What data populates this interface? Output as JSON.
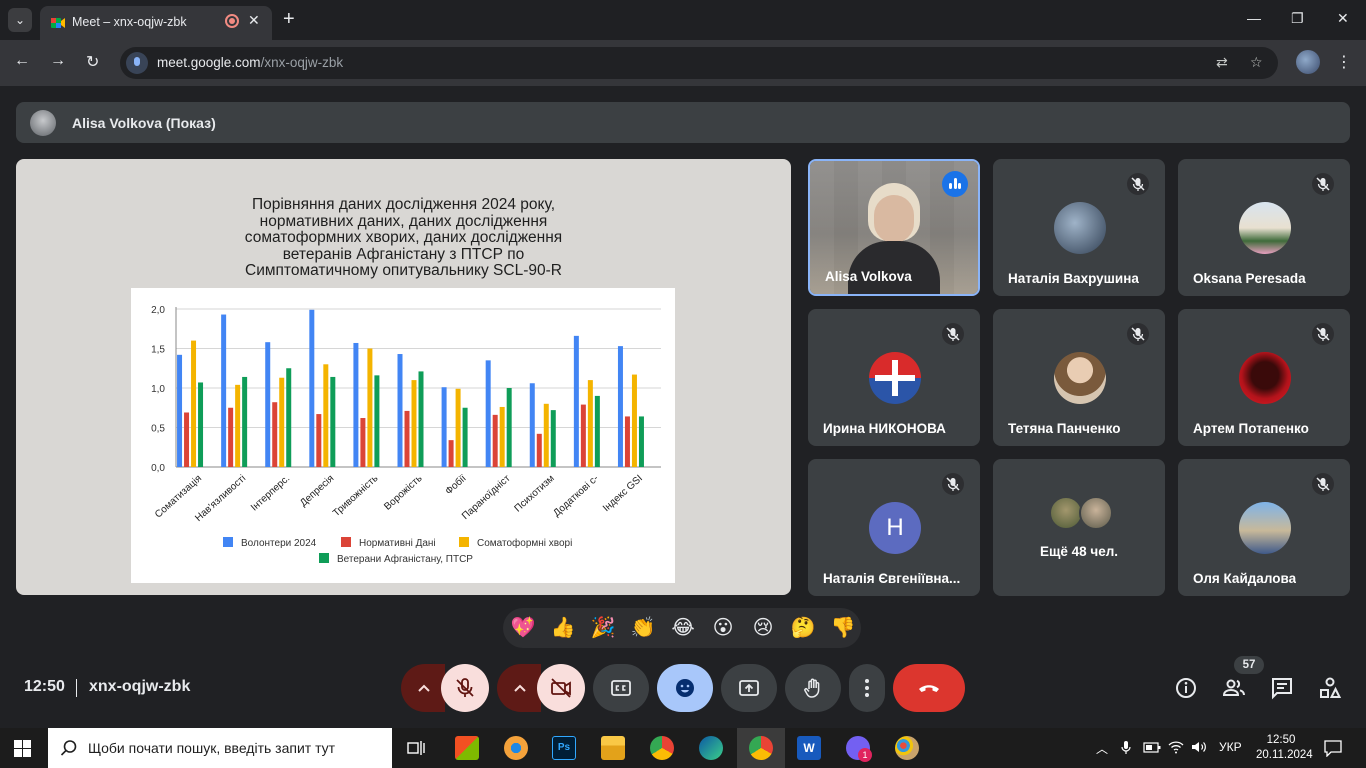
{
  "browser": {
    "tab_title": "Meet – xnx-oqjw-zbk",
    "url_host": "meet.google.com",
    "url_path": "/xnx-oqjw-zbk"
  },
  "presenter": {
    "label": "Alisa Volkova (Показ)"
  },
  "slide": {
    "title": "Порівняння даних дослідження 2024 року,\nнормативних даних, даних дослідження\nсоматоформних хворих, даних дослідження\nветеранів Афганістану з ПТСР по\nСимптоматичному опитувальнику SCL-90-R"
  },
  "chart_data": {
    "type": "bar",
    "categories": [
      "Соматизація",
      "Нав'язливості",
      "Інтерперс.",
      "Депресія",
      "Тривожність",
      "Ворожість",
      "Фобії",
      "Параноїдніст",
      "Психотизм",
      "Додаткові с-",
      "Індекс GSI"
    ],
    "series": [
      {
        "name": "Волонтери 2024",
        "color": "#4285f4",
        "values": [
          1.42,
          1.93,
          1.58,
          1.99,
          1.57,
          1.43,
          1.01,
          1.35,
          1.06,
          1.66,
          1.53
        ]
      },
      {
        "name": "Нормативні Дані",
        "color": "#db4437",
        "values": [
          0.69,
          0.75,
          0.82,
          0.67,
          0.62,
          0.71,
          0.34,
          0.66,
          0.42,
          0.79,
          0.64
        ]
      },
      {
        "name": "Соматоформні хворі",
        "color": "#f4b400",
        "values": [
          1.6,
          1.04,
          1.13,
          1.3,
          1.5,
          1.1,
          0.99,
          0.76,
          0.8,
          1.1,
          1.17
        ]
      },
      {
        "name": "Ветерани Афганістану, ПТСР",
        "color": "#0f9d58",
        "values": [
          1.07,
          1.14,
          1.25,
          1.14,
          1.16,
          1.21,
          0.75,
          1.0,
          0.72,
          0.9,
          0.64
        ]
      }
    ],
    "ylim": [
      0,
      2
    ],
    "yticks": [
      "0,0",
      "0,5",
      "1,0",
      "1,5",
      "2,0"
    ],
    "grid": true,
    "legend_position": "bottom"
  },
  "tiles": [
    {
      "name": "Alisa Volkova",
      "speaking": true
    },
    {
      "name": "Наталія Вахрушина"
    },
    {
      "name": "Oksana Peresada"
    },
    {
      "name": "Ирина НИКОНОВА"
    },
    {
      "name": "Тетяна Панченко"
    },
    {
      "name": "Артем Потапенко"
    },
    {
      "name": "Наталія Євгеніївна...",
      "initial": "Н"
    },
    {
      "more": "Ещё 48 чел."
    },
    {
      "name": "Оля Кайдалова"
    }
  ],
  "reactions": [
    "💖",
    "👍",
    "🎉",
    "👏",
    "😂",
    "😮",
    "😢",
    "🤔",
    "👎"
  ],
  "meeting": {
    "time": "12:50",
    "code": "xnx-oqjw-zbk",
    "participants_count": "57"
  },
  "taskbar": {
    "search_placeholder": "Щоби почати пошук, введіть запит тут",
    "lang": "УКР",
    "time": "12:50",
    "date": "20.11.2024",
    "viber_badge": "1"
  }
}
